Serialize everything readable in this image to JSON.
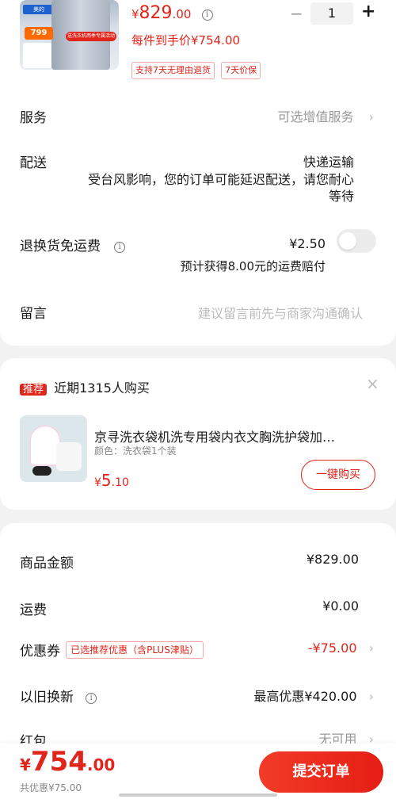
{
  "product": {
    "thumb_brand": "美的",
    "thumb_price_tag": "799",
    "thumb_promo": "送洗衣机两季专属活动",
    "price_symbol": "¥",
    "price_int": "829",
    "price_dec": ".00",
    "net_price": "每件到手价¥754.00",
    "tags": [
      "支持7天无理由退货",
      "7天价保"
    ],
    "qty": "1",
    "minus": "−",
    "plus": "+"
  },
  "service": {
    "label": "服务",
    "value": "可选增值服务"
  },
  "delivery": {
    "label": "配送",
    "method": "快递运输",
    "notice_line1": "受台风影响，您的订单可能延迟配送，请您耐心",
    "notice_line2": "等待"
  },
  "return_shipping": {
    "label": "退换货免运费",
    "price": "¥2.50",
    "note": "预计获得8.00元的运费赔付",
    "enabled": false
  },
  "remark": {
    "label": "留言",
    "placeholder": "建议留言前先与商家沟通确认"
  },
  "recommend": {
    "badge": "推荐",
    "title": "近期1315人购买",
    "item_title": "京寻洗衣袋机洗专用袋内衣文胸洗护袋加…",
    "item_spec": "颜色：洗衣袋1个装",
    "price_symbol": "¥",
    "price_int": "5",
    "price_dec": ".10",
    "buy_label": "一键购买",
    "close": "×"
  },
  "summary": {
    "goods_label": "商品金额",
    "goods_value": "¥829.00",
    "shipping_label": "运费",
    "shipping_value": "¥0.00",
    "coupon_label": "优惠券",
    "coupon_tag": "已选推荐优惠（含PLUS津贴）",
    "coupon_value": "-¥75.00",
    "tradein_label": "以旧换新",
    "tradein_value": "最高优惠¥420.00",
    "redpacket_label": "红包",
    "redpacket_value": "无可用"
  },
  "footer": {
    "total_symbol": "¥",
    "total_int": "754",
    "total_dec": ".00",
    "discount": "共优惠¥75.00",
    "submit": "提交订单"
  },
  "colors": {
    "accent": "#e1251b",
    "background": "#f2f2f2"
  }
}
